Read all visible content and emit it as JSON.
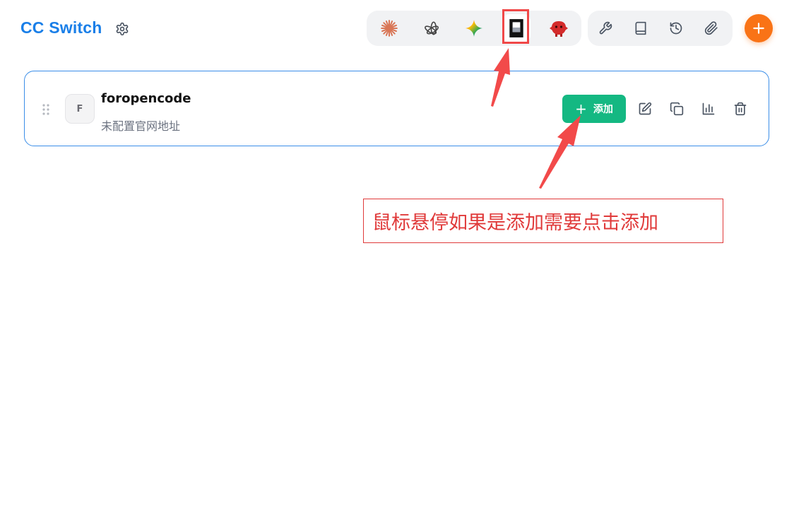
{
  "app": {
    "title": "CC Switch"
  },
  "header": {
    "apps": [
      {
        "name": "claude",
        "icon": "claude-starburst-icon",
        "active": false
      },
      {
        "name": "openai",
        "icon": "openai-knot-icon",
        "active": false
      },
      {
        "name": "gemini",
        "icon": "gemini-sparkle-icon",
        "active": false
      },
      {
        "name": "opencode",
        "icon": "opencode-square-icon",
        "active": true
      },
      {
        "name": "red-mascot",
        "icon": "red-mascot-icon",
        "active": false
      }
    ],
    "tools": [
      {
        "icon": "wrench-icon"
      },
      {
        "icon": "book-icon"
      },
      {
        "icon": "history-icon"
      },
      {
        "icon": "paperclip-icon"
      }
    ]
  },
  "provider": {
    "avatar_letter": "F",
    "name": "foropencode",
    "subtitle": "未配置官网地址",
    "add_label": "添加"
  },
  "annotation": {
    "text": "鼠标悬停如果是添加需要点击添加"
  },
  "colors": {
    "brand": "#1a7fe8",
    "add_green": "#14b882",
    "fab_orange": "#f97316",
    "annotation_red": "#e03a3a"
  }
}
